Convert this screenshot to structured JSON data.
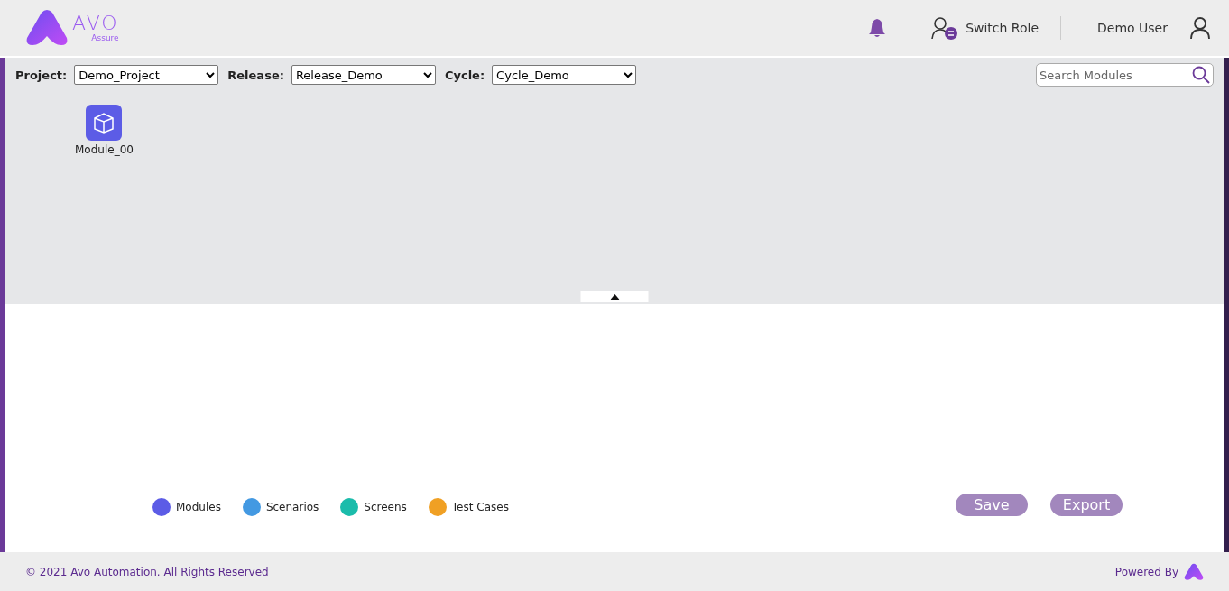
{
  "logo": {
    "name": "AVO",
    "sub": "Assure"
  },
  "header": {
    "switch_role": "Switch Role",
    "user": "Demo User"
  },
  "filters": [
    {
      "label": "Project:",
      "value": "Demo_Project"
    },
    {
      "label": "Release:",
      "value": "Release_Demo"
    },
    {
      "label": "Cycle:",
      "value": "Cycle_Demo"
    }
  ],
  "search": {
    "placeholder": "Search Modules"
  },
  "modules": [
    {
      "name": "Module_00"
    }
  ],
  "legend": [
    {
      "label": "Modules",
      "color": "#5c5ce6"
    },
    {
      "label": "Scenarios",
      "color": "#4399e2"
    },
    {
      "label": "Screens",
      "color": "#1bbcab"
    },
    {
      "label": "Test Cases",
      "color": "#f0a024"
    }
  ],
  "buttons": [
    "Save",
    "Export"
  ],
  "footer": {
    "copyright": "© 2021 Avo Automation. All Rights Reserved",
    "powered_by": "Powered By"
  }
}
